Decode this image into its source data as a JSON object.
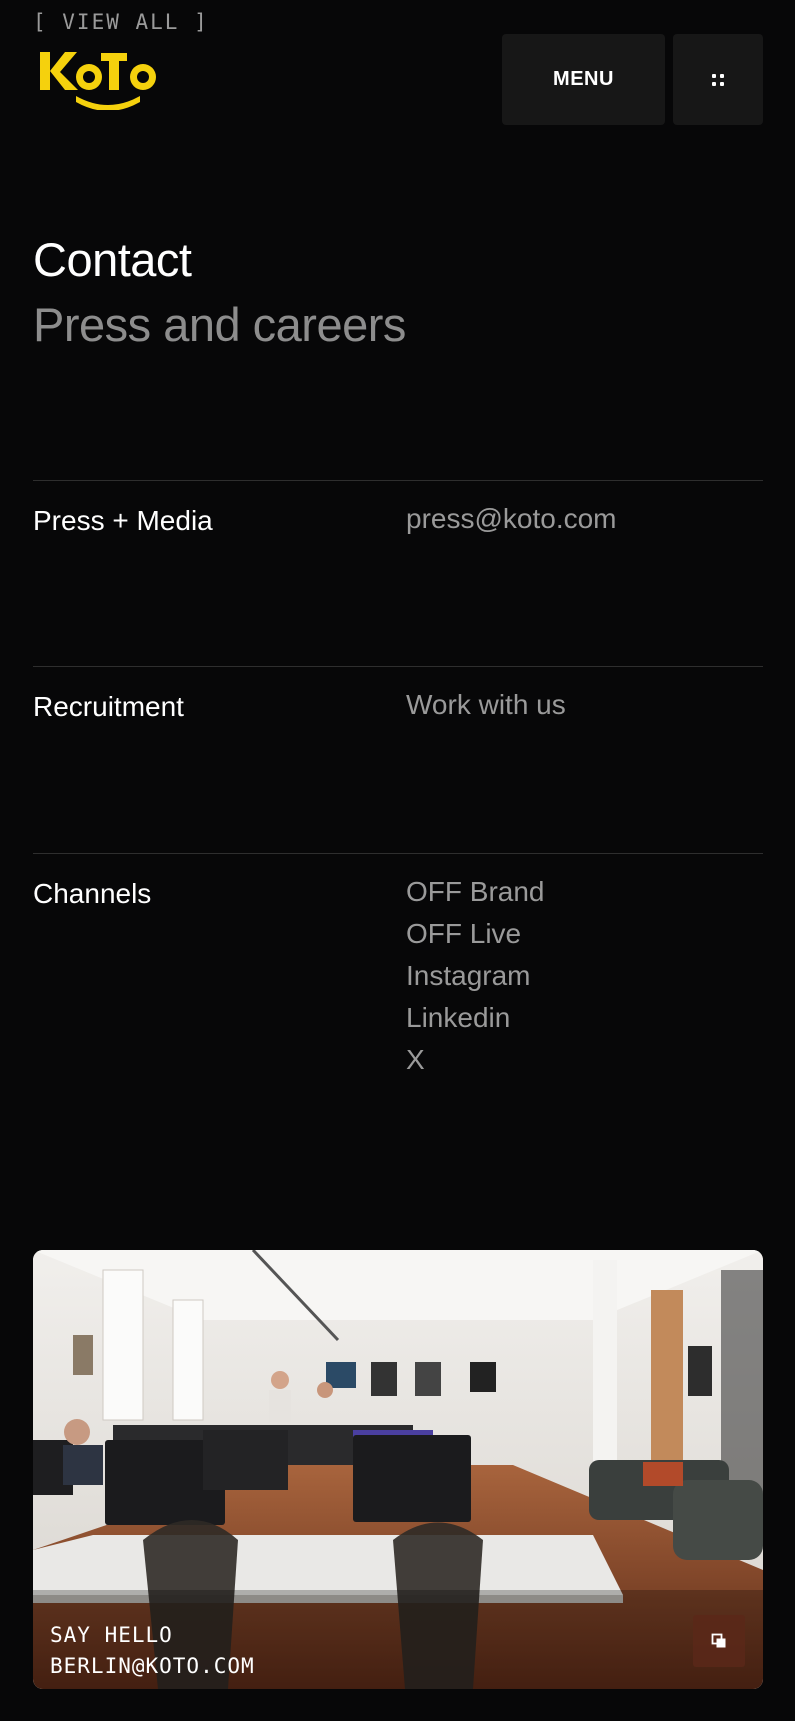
{
  "header": {
    "view_all": "[ VIEW ALL ]",
    "logo_text": "KOTO",
    "menu_label": "MENU",
    "brand_color": "#F5D10D"
  },
  "hero": {
    "title": "Contact",
    "subtitle": "Press and careers"
  },
  "rows": [
    {
      "label": "Press + Media",
      "values": [
        "press@koto.com"
      ]
    },
    {
      "label": "Recruitment",
      "values": [
        "Work with us"
      ]
    },
    {
      "label": "Channels",
      "values": [
        "OFF Brand",
        "OFF Live",
        "Instagram",
        "Linkedin",
        "X"
      ]
    }
  ],
  "footer_card": {
    "line1": "SAY HELLO",
    "line2": "BERLIN@KOTO.COM",
    "icon": "external-link-icon"
  }
}
